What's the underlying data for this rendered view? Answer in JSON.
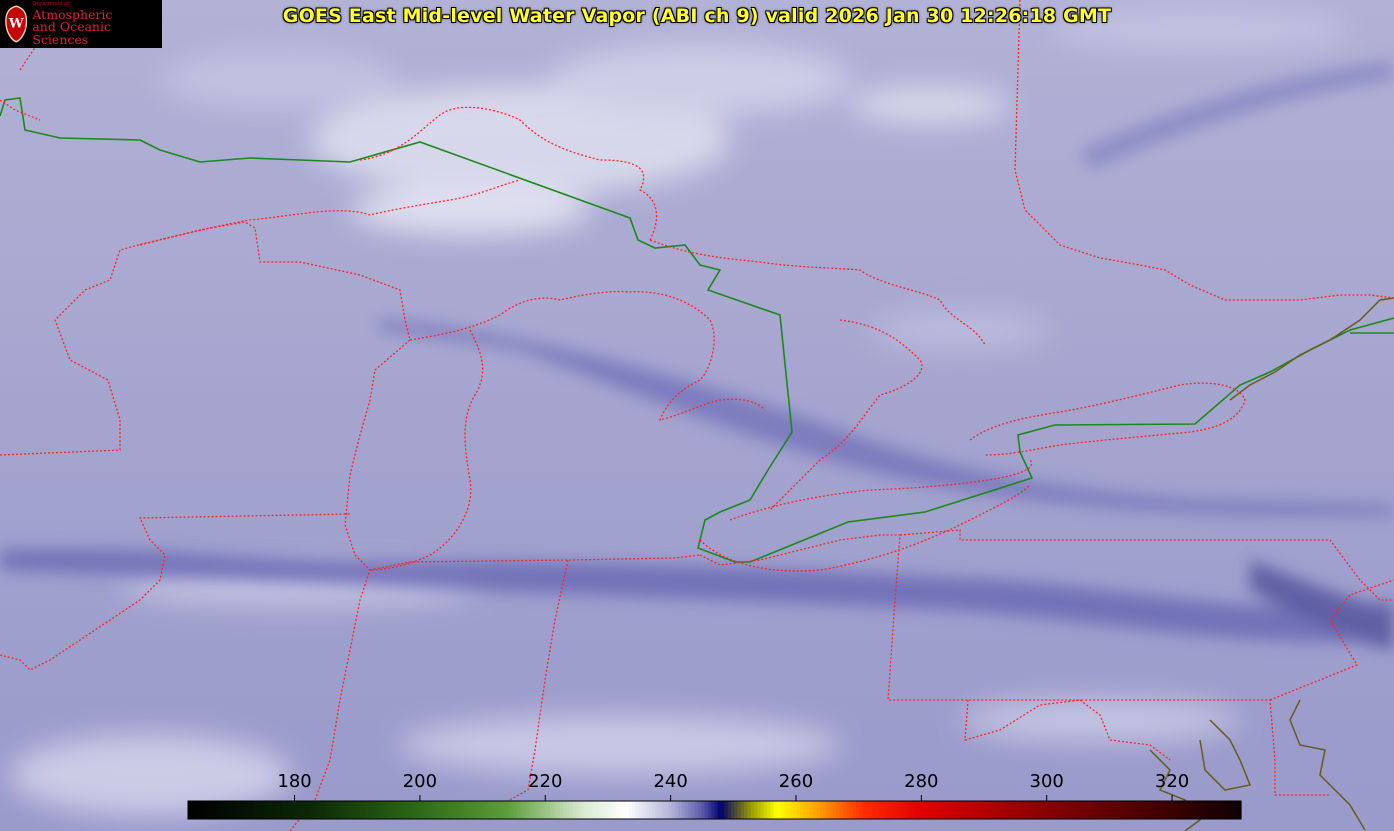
{
  "title": "GOES East Mid-level Water Vapor (ABI ch 9)  valid 2026 Jan 30 12:26:18 GMT",
  "logo": {
    "dept": "Department of",
    "line1": "Atmospheric",
    "line2": "and Oceanic Sciences",
    "crest_letter": "W"
  },
  "colorbar": {
    "ticks": [
      "180",
      "200",
      "220",
      "240",
      "260",
      "280",
      "300",
      "320"
    ],
    "tick_values": [
      180,
      200,
      220,
      240,
      260,
      280,
      300,
      320
    ],
    "range": [
      163,
      331
    ],
    "colors": {
      "stops": [
        [
          163,
          "#000000"
        ],
        [
          183,
          "#0c2a05"
        ],
        [
          200,
          "#2e6a17"
        ],
        [
          214,
          "#5d9e3a"
        ],
        [
          226,
          "#d8ead0"
        ],
        [
          233,
          "#ffffff"
        ],
        [
          240,
          "#b4b4d8"
        ],
        [
          245,
          "#5c5cac"
        ],
        [
          248,
          "#00006e"
        ],
        [
          253,
          "#a0a000"
        ],
        [
          257,
          "#ffff00"
        ],
        [
          264,
          "#ff9900"
        ],
        [
          271,
          "#ff2a00"
        ],
        [
          280,
          "#e00000"
        ],
        [
          300,
          "#880000"
        ],
        [
          331,
          "#100000"
        ]
      ]
    }
  },
  "colors": {
    "background_vapor": "#a8a8d0",
    "state_border": "#ff2020",
    "intl_border": "#1a8a1a",
    "coast": "#6b5a1e",
    "title": "#ffff33"
  }
}
